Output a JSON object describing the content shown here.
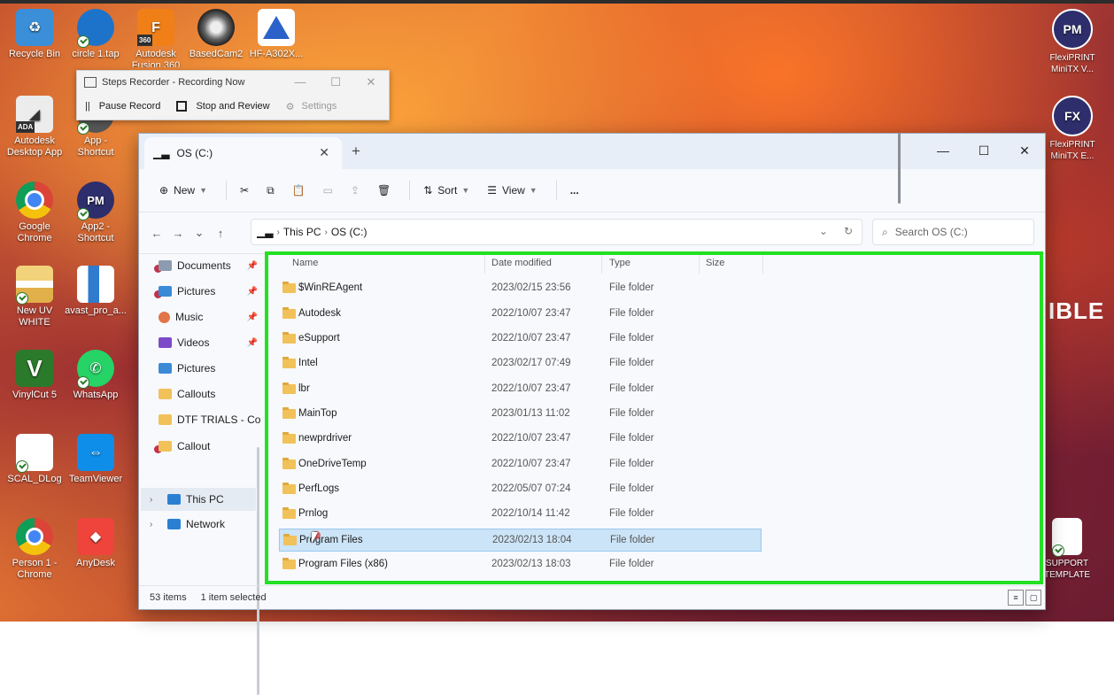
{
  "desktop": {
    "icons": [
      {
        "label": "Recycle Bin"
      },
      {
        "label": "circle 1.tap"
      },
      {
        "label": "Autodesk Fusion 360",
        "badge": "360"
      },
      {
        "label": "BasedCam2"
      },
      {
        "label": "HF-A302X..."
      },
      {
        "label": "Autodesk Desktop App",
        "badge": "ADA"
      },
      {
        "label": "App - Shortcut"
      },
      {
        "label": "Google Chrome"
      },
      {
        "label": "App2 - Shortcut",
        "badge": "PM"
      },
      {
        "label": "New UV WHITE"
      },
      {
        "label": "avast_pro_a..."
      },
      {
        "label": "VinylCut 5"
      },
      {
        "label": "WhatsApp"
      },
      {
        "label": "SCAL_DLog"
      },
      {
        "label": "TeamViewer"
      },
      {
        "label": "Person 1 - Chrome"
      },
      {
        "label": "AnyDesk"
      },
      {
        "label": "FlexiPRINT MiniTX V...",
        "badge": "PM"
      },
      {
        "label": "FlexiPRINT MiniTX E...",
        "badge": "FX"
      },
      {
        "label": "SUPPORT TEMPLATE"
      }
    ],
    "wallpaper_text": "IBLE"
  },
  "steps_recorder": {
    "title": "Steps Recorder - Recording Now",
    "pause": "Pause Record",
    "stop": "Stop and Review",
    "settings": "Settings"
  },
  "explorer": {
    "tab": "OS (C:)",
    "toolbar": {
      "new": "New",
      "sort": "Sort",
      "view": "View",
      "more": "..."
    },
    "breadcrumb": [
      "This PC",
      "OS (C:)"
    ],
    "search_placeholder": "Search OS (C:)",
    "sidebar": [
      {
        "label": "Documents",
        "pinned": true
      },
      {
        "label": "Pictures",
        "pinned": true
      },
      {
        "label": "Music",
        "pinned": true
      },
      {
        "label": "Videos",
        "pinned": true
      },
      {
        "label": "Pictures"
      },
      {
        "label": "Callouts"
      },
      {
        "label": "DTF TRIALS - Co"
      },
      {
        "label": "Callout"
      },
      {
        "label": "This PC"
      },
      {
        "label": "Network"
      }
    ],
    "columns": {
      "name": "Name",
      "date": "Date modified",
      "type": "Type",
      "size": "Size"
    },
    "files": [
      {
        "name": "$WinREAgent",
        "date": "2023/02/15 23:56",
        "type": "File folder"
      },
      {
        "name": "Autodesk",
        "date": "2022/10/07 23:47",
        "type": "File folder"
      },
      {
        "name": "eSupport",
        "date": "2022/10/07 23:47",
        "type": "File folder"
      },
      {
        "name": "Intel",
        "date": "2023/02/17 07:49",
        "type": "File folder"
      },
      {
        "name": "lbr",
        "date": "2022/10/07 23:47",
        "type": "File folder"
      },
      {
        "name": "MainTop",
        "date": "2023/01/13 11:02",
        "type": "File folder"
      },
      {
        "name": "newprdriver",
        "date": "2022/10/07 23:47",
        "type": "File folder"
      },
      {
        "name": "OneDriveTemp",
        "date": "2022/10/07 23:47",
        "type": "File folder"
      },
      {
        "name": "PerfLogs",
        "date": "2022/05/07 07:24",
        "type": "File folder"
      },
      {
        "name": "Prnlog",
        "date": "2022/10/14 11:42",
        "type": "File folder"
      },
      {
        "name": "Program Files",
        "date": "2023/02/13 18:04",
        "type": "File folder",
        "selected": true
      },
      {
        "name": "Program Files (x86)",
        "date": "2023/02/13 18:03",
        "type": "File folder"
      }
    ],
    "status": {
      "count": "53 items",
      "selected": "1 item selected"
    }
  },
  "colors": {
    "highlight_box": "#22e022",
    "selection": "#cce4f7"
  }
}
